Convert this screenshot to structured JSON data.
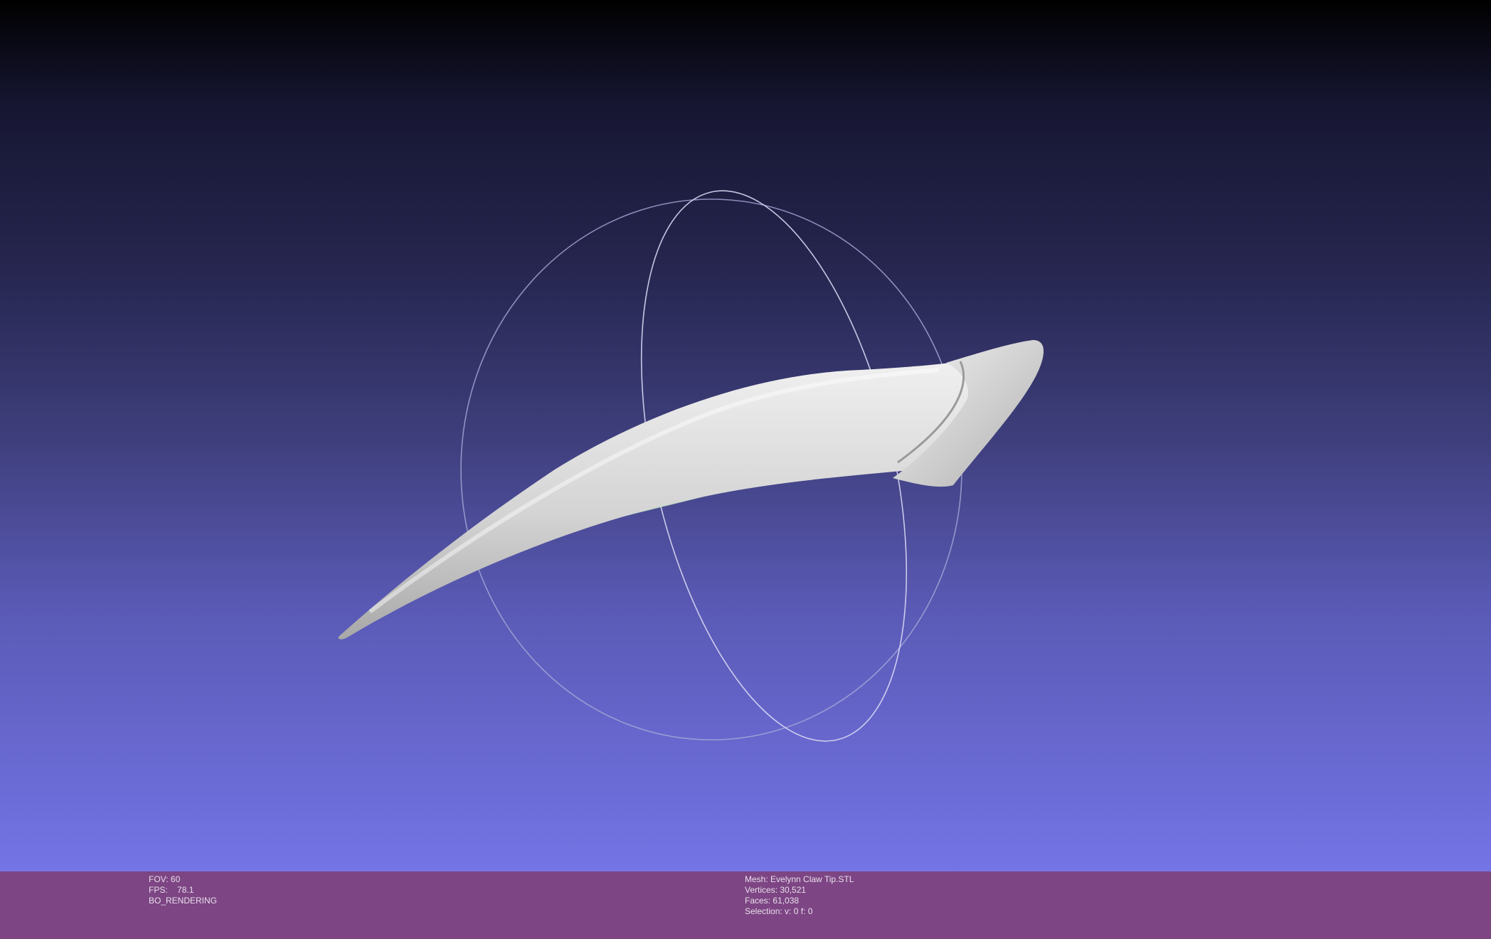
{
  "viewport": {
    "background_top": "#000000",
    "background_bottom": "#7474e6",
    "mesh_color": "#d6d6d6",
    "trackball_color": "#c8c8e8"
  },
  "status": {
    "bar_color": "#7d4584",
    "fov": "FOV: 60",
    "fps_label": "FPS:",
    "fps_value": "78.1",
    "render_mode": "BO_RENDERING",
    "mesh_name": "Mesh: Evelynn Claw Tip.STL",
    "vertices": "Vertices: 30,521",
    "faces": "Faces: 61,038",
    "selection": "Selection: v: 0 f: 0"
  }
}
